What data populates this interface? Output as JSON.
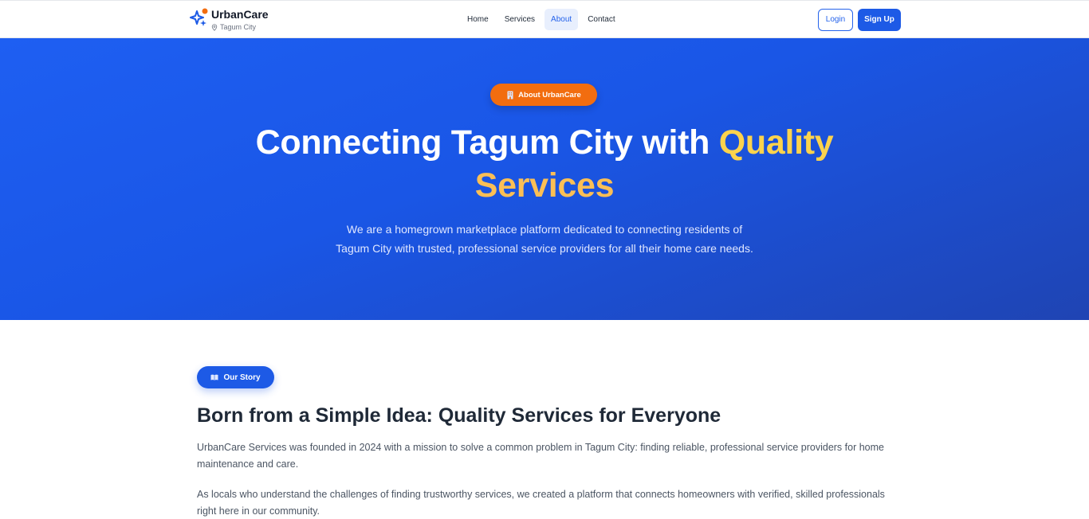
{
  "nav": {
    "brand_name": "UrbanCare",
    "brand_location": "Tagum City",
    "links": [
      {
        "label": "Home",
        "active": false
      },
      {
        "label": "Services",
        "active": false
      },
      {
        "label": "About",
        "active": true
      },
      {
        "label": "Contact",
        "active": false
      }
    ],
    "login_label": "Login",
    "signup_label": "Sign Up"
  },
  "hero": {
    "pill_label": "About UrbanCare",
    "title_part1": "Connecting Tagum City with ",
    "title_highlight1": "Quality",
    "title_highlight2": "Services",
    "subtitle_line1": "We are a homegrown marketplace platform dedicated to connecting residents of",
    "subtitle_line2": "Tagum City with trusted, professional service providers for all their home care needs."
  },
  "story": {
    "pill_label": "Our Story",
    "title": "Born from a Simple Idea: Quality Services for Everyone",
    "paragraph1": "UrbanCare Services was founded in 2024 with a mission to solve a common problem in Tagum City: finding reliable, professional service providers for home maintenance and care.",
    "paragraph2": "As locals who understand the challenges of finding trustworthy services, we created a platform that connects homeowners with verified, skilled professionals right here in our community."
  },
  "colors": {
    "primary": "#1d5ae6",
    "accent_orange": "#f26d0f",
    "highlight_yellow": "#fcd34d"
  },
  "icons": {
    "brand": "sparkle-logo-icon",
    "location": "map-pin-icon",
    "hero_pill": "building-icon",
    "story_pill": "book-icon"
  }
}
